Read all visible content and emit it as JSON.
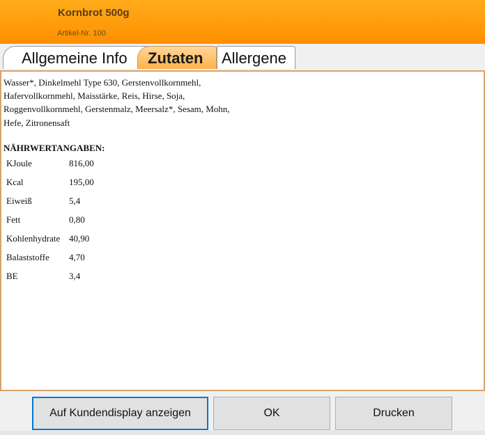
{
  "header": {
    "title": "Kornbrot 500g",
    "subtitle": "Artikel-Nr. 100"
  },
  "tabs": [
    {
      "label": "Allgemeine Info"
    },
    {
      "label": "Zutaten"
    },
    {
      "label": "Allergene"
    }
  ],
  "content": {
    "ingredients": "Wasser*, Dinkelmehl Type 630, Gerstenvollkornmehl, Hafervollkornmehl, Maisstärke, Reis, Hirse, Soja, Roggenvollkornmehl, Gerstenmalz, Meersalz*, Sesam, Mohn, Hefe, Zitronensaft",
    "nutrition_heading": "NÄHRWERTANGABEN:",
    "nutrition": [
      {
        "name": "KJoule",
        "value": "816,00"
      },
      {
        "name": "Kcal",
        "value": "195,00"
      },
      {
        "name": "Eiweiß",
        "value": "5,4"
      },
      {
        "name": "Fett",
        "value": "0,80"
      },
      {
        "name": "Kohlenhydrate",
        "value": "40,90"
      },
      {
        "name": "Balaststoffe",
        "value": "4,70"
      },
      {
        "name": "BE",
        "value": "3,4"
      }
    ]
  },
  "buttons": {
    "display": "Auf Kundendisplay anzeigen",
    "ok": "OK",
    "print": "Drucken"
  }
}
